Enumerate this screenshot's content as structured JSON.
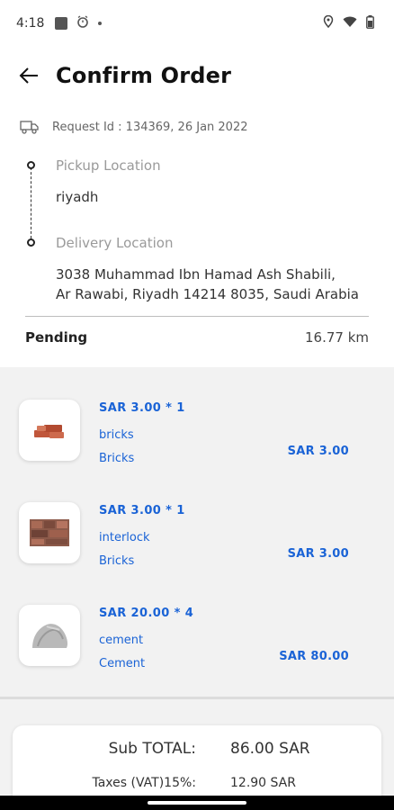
{
  "status_bar": {
    "time": "4:18"
  },
  "header": {
    "title": "Confirm Order"
  },
  "request": {
    "text": "Request Id : 134369, 26 Jan 2022"
  },
  "route": {
    "pickup_label": "Pickup Location",
    "pickup_value": "riyadh",
    "delivery_label": "Delivery Location",
    "delivery_line1": "3038 Muhammad Ibn Hamad Ash Shabili,",
    "delivery_line2": "Ar Rawabi, Riyadh 14214 8035, Saudi Arabia"
  },
  "order": {
    "status": "Pending",
    "distance": "16.77 km"
  },
  "items": [
    {
      "price_qty": "SAR  3.00  * 1",
      "name": "bricks",
      "category": "Bricks",
      "total": "SAR  3.00"
    },
    {
      "price_qty": "SAR  3.00  * 1",
      "name": "interlock",
      "category": "Bricks",
      "total": "SAR  3.00"
    },
    {
      "price_qty": "SAR  20.00  * 4",
      "name": "cement",
      "category": "Cement",
      "total": "SAR  80.00"
    }
  ],
  "summary": {
    "subtotal_label": "Sub TOTAL:",
    "subtotal_value": "86.00 SAR",
    "tax_label": "Taxes (VAT)15%:",
    "tax_value": "12.90 SAR"
  },
  "colors": {
    "accent": "#1a63d6",
    "section_bg": "#f2f2f2"
  }
}
